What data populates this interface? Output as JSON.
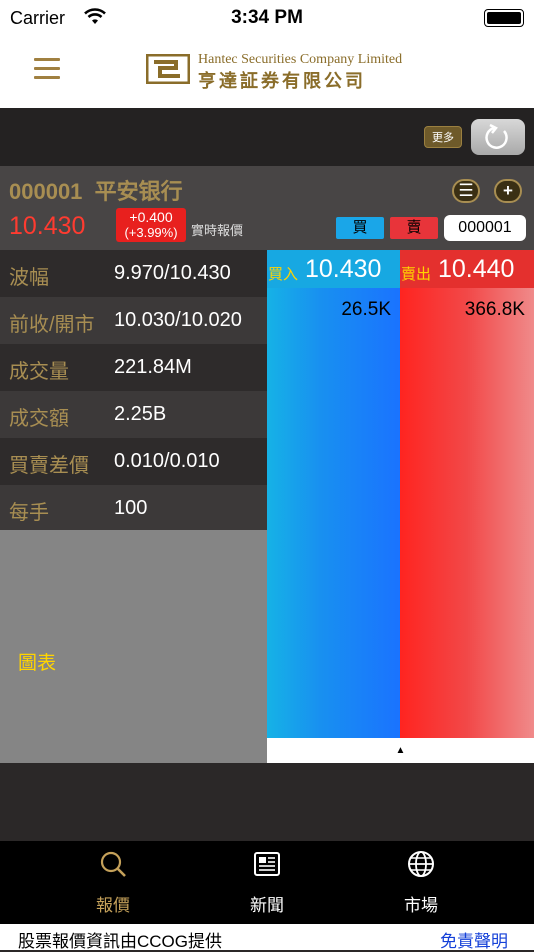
{
  "status_bar": {
    "carrier": "Carrier",
    "time": "3:34 PM"
  },
  "header": {
    "logo_en": "Hantec Securities Company Limited",
    "logo_zh": "亨達証券有限公司"
  },
  "toolbar": {
    "more_label": "更多"
  },
  "quote": {
    "code": "000001",
    "name": "平安银行",
    "price": "10.430",
    "change": "+0.400",
    "change_pct": "(+3.99%)",
    "realtime_label": "實時報價",
    "list_btn": "☰",
    "add_btn": "+",
    "buy_label": "買",
    "sell_label": "賣",
    "code_input_value": "000001"
  },
  "details": [
    {
      "label": "波幅",
      "value": "9.970/10.430"
    },
    {
      "label": "前收/開市",
      "value": "10.030/10.020"
    },
    {
      "label": "成交量",
      "value": "221.84M"
    },
    {
      "label": "成交額",
      "value": "2.25B"
    },
    {
      "label": "買賣差價",
      "value": "0.010/0.010"
    },
    {
      "label": "每手",
      "value": "100"
    }
  ],
  "chart_label": "圖表",
  "bid": {
    "label": "買入",
    "price": "10.430",
    "volume": "26.5K"
  },
  "ask": {
    "label": "賣出",
    "price": "10.440",
    "volume": "366.8K"
  },
  "expander": "▲",
  "tabs": [
    {
      "label": "報價",
      "icon": "search-icon",
      "active": true
    },
    {
      "label": "新聞",
      "icon": "newspaper-icon",
      "active": false
    },
    {
      "label": "市場",
      "icon": "globe-icon",
      "active": false
    }
  ],
  "footer": {
    "source": "股票報價資訊由CCOG提供",
    "disclaimer": "免責聲明"
  },
  "colors": {
    "gold": "#a88e52",
    "price_red": "#ff3b30",
    "bid_blue": "#1a8ff0",
    "ask_red": "#e8343a",
    "chart_label_yellow": "#ffd400"
  }
}
